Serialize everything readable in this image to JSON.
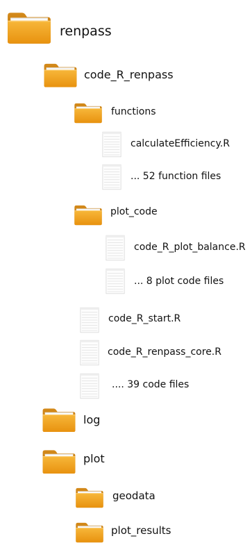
{
  "tree": {
    "items": [
      {
        "label": "renpass",
        "icon": "folder-icon"
      },
      {
        "label": "code_R_renpass",
        "icon": "folder-icon"
      },
      {
        "label": "functions",
        "icon": "folder-icon"
      },
      {
        "label": "calculateEfficiency.R",
        "icon": "file-icon"
      },
      {
        "label": "... 52 function files",
        "icon": "file-icon"
      },
      {
        "label": "plot_code",
        "icon": "folder-icon"
      },
      {
        "label": "code_R_plot_balance.R",
        "icon": "file-icon"
      },
      {
        "label": "... 8 plot code files",
        "icon": "file-icon"
      },
      {
        "label": "code_R_start.R",
        "icon": "file-icon"
      },
      {
        "label": "code_R_renpass_core.R",
        "icon": "file-icon"
      },
      {
        "label": ".... 39 code files",
        "icon": "file-icon"
      },
      {
        "label": "log",
        "icon": "folder-icon"
      },
      {
        "label": "plot",
        "icon": "folder-icon"
      },
      {
        "label": "geodata",
        "icon": "folder-icon"
      },
      {
        "label": "plot_results",
        "icon": "folder-icon"
      }
    ]
  },
  "colors": {
    "folder_front": "#f2a41f",
    "folder_back": "#d98a12",
    "folder_tab": "#c77d12",
    "paper": "#fdfdfd",
    "file_line": "#dcdcdc",
    "file_border": "#cfcfcf"
  }
}
